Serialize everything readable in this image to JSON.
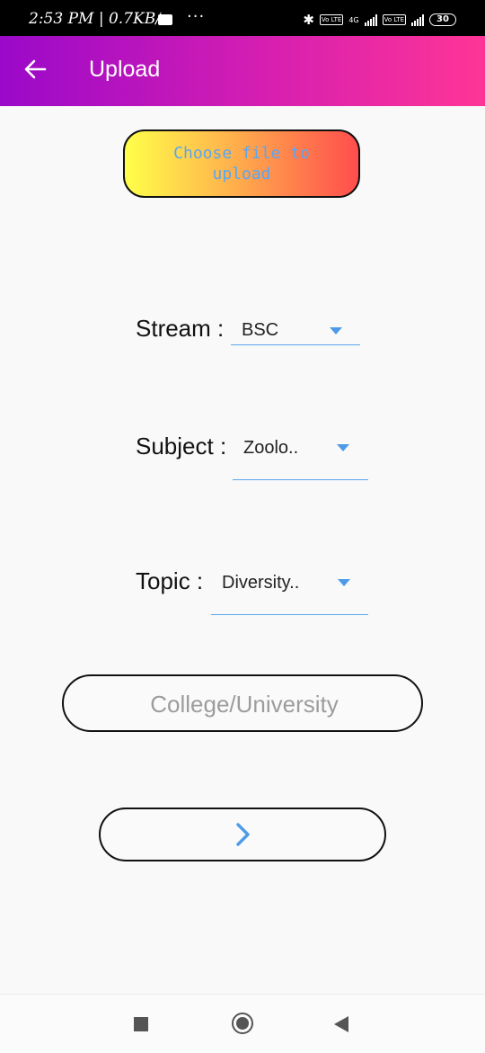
{
  "status_bar": {
    "time_speed": "2:53 PM | 0.7KB/s",
    "dots": "···",
    "battery": "30",
    "network_label": "4G",
    "volte_label": "Vo LTE"
  },
  "app_bar": {
    "title": "Upload",
    "icon": "back-arrow-icon"
  },
  "upload": {
    "choose_label": "Choose file to upload"
  },
  "form": {
    "stream": {
      "label": "Stream :",
      "value": "BSC"
    },
    "subject": {
      "label": "Subject :",
      "value": "Zoolo.."
    },
    "topic": {
      "label": "Topic :",
      "value": "Diversity.."
    },
    "college": {
      "placeholder": "College/University",
      "value": ""
    },
    "next_icon": "chevron-right-icon"
  },
  "colors": {
    "appbar_start": "#9a09c9",
    "appbar_end": "#ff3596",
    "accent_blue": "#4d9be8"
  }
}
